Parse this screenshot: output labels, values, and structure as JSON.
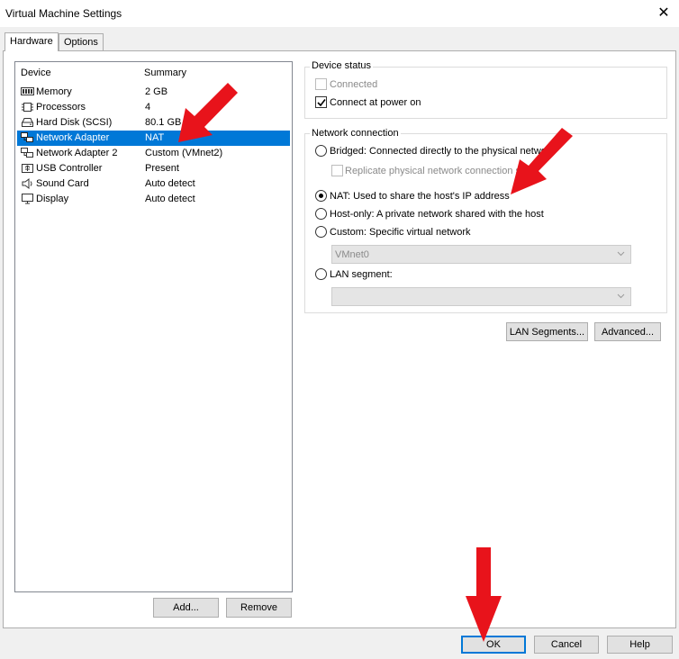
{
  "window": {
    "title": "Virtual Machine Settings",
    "close_glyph": "✕"
  },
  "tabs": [
    {
      "label": "Hardware",
      "active": true
    },
    {
      "label": "Options",
      "active": false
    }
  ],
  "device_list": {
    "columns": {
      "device": "Device",
      "summary": "Summary"
    },
    "rows": [
      {
        "name": "Memory",
        "summary": "2 GB",
        "icon": "memory-icon"
      },
      {
        "name": "Processors",
        "summary": "4",
        "icon": "processor-icon"
      },
      {
        "name": "Hard Disk (SCSI)",
        "summary": "80.1 GB",
        "icon": "hard-disk-icon"
      },
      {
        "name": "Network Adapter",
        "summary": "NAT",
        "icon": "network-adapter-icon",
        "selected": true
      },
      {
        "name": "Network Adapter 2",
        "summary": "Custom (VMnet2)",
        "icon": "network-adapter-icon"
      },
      {
        "name": "USB Controller",
        "summary": "Present",
        "icon": "usb-icon"
      },
      {
        "name": "Sound Card",
        "summary": "Auto detect",
        "icon": "sound-card-icon"
      },
      {
        "name": "Display",
        "summary": "Auto detect",
        "icon": "display-icon"
      }
    ],
    "add_label": "Add...",
    "remove_label": "Remove"
  },
  "device_status": {
    "title": "Device status",
    "connected_label": "Connected",
    "connected_checked": false,
    "connected_enabled": false,
    "power_on_label": "Connect at power on",
    "power_on_checked": true
  },
  "network_connection": {
    "title": "Network connection",
    "bridged_label": "Bridged: Connected directly to the physical netwo",
    "replicate_label": "Replicate physical network connection sta",
    "nat_label": "NAT: Used to share the host's IP address",
    "hostonly_label": "Host-only: A private network shared with the host",
    "custom_label": "Custom: Specific virtual network",
    "custom_combo_value": "VMnet0",
    "lan_label": "LAN segment:",
    "lan_combo_value": "",
    "selected": "nat"
  },
  "side_buttons": {
    "lan_segments_label": "LAN Segments...",
    "advanced_label": "Advanced..."
  },
  "footer": {
    "ok_label": "OK",
    "cancel_label": "Cancel",
    "help_label": "Help"
  },
  "colors": {
    "selection": "#0078d7",
    "annotation_arrow": "#e8131b"
  }
}
